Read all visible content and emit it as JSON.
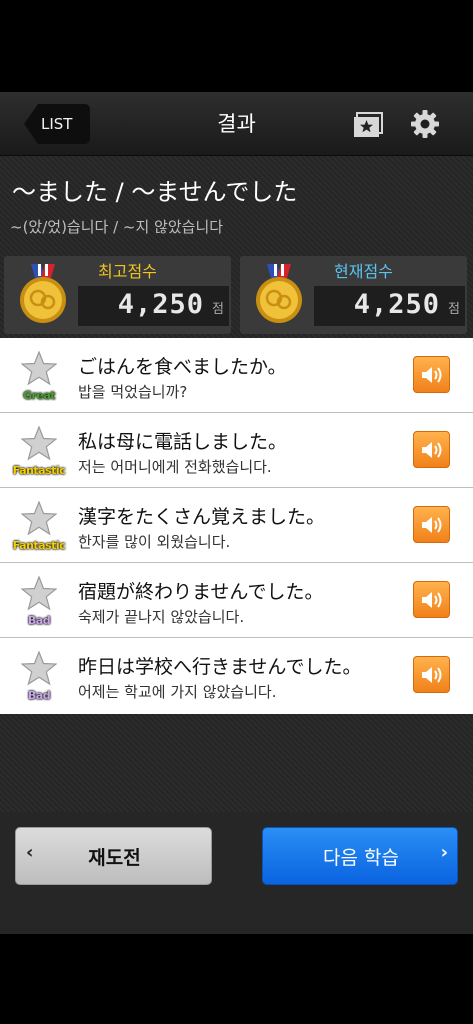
{
  "header": {
    "back_label": "LIST",
    "title": "결과",
    "bookmark_icon": "bookmark-star-icon",
    "settings_icon": "gear-icon"
  },
  "lesson": {
    "title": "〜ました / 〜ませんでした",
    "subtitle": "~(았/었)습니다 / ~지 않았습니다"
  },
  "scores": {
    "best": {
      "label": "최고점수",
      "value": "4,250",
      "unit": "점"
    },
    "current": {
      "label": "현재점수",
      "value": "4,250",
      "unit": "점"
    }
  },
  "items": [
    {
      "grade": "Great",
      "japanese": "ごはんを食べましたか。",
      "korean": "밥을 먹었습니까?"
    },
    {
      "grade": "Fantastic",
      "japanese": "私は母に電話しました。",
      "korean": "저는 어머니에게 전화했습니다."
    },
    {
      "grade": "Fantastic",
      "japanese": "漢字をたくさん覚えました。",
      "korean": "한자를 많이 외웠습니다."
    },
    {
      "grade": "Bad",
      "japanese": "宿題が終わりませんでした。",
      "korean": "숙제가 끝나지 않았습니다."
    },
    {
      "grade": "Bad",
      "japanese": "昨日は学校へ行きませんでした。",
      "korean": "어제는 학교에 가지 않았습니다."
    }
  ],
  "footer": {
    "retry_label": "재도전",
    "next_label": "다음 학습"
  },
  "colors": {
    "accent_orange": "#f1811a",
    "accent_blue": "#0a63e0",
    "gold": "#f2c521",
    "cyan": "#5bc3ee"
  }
}
